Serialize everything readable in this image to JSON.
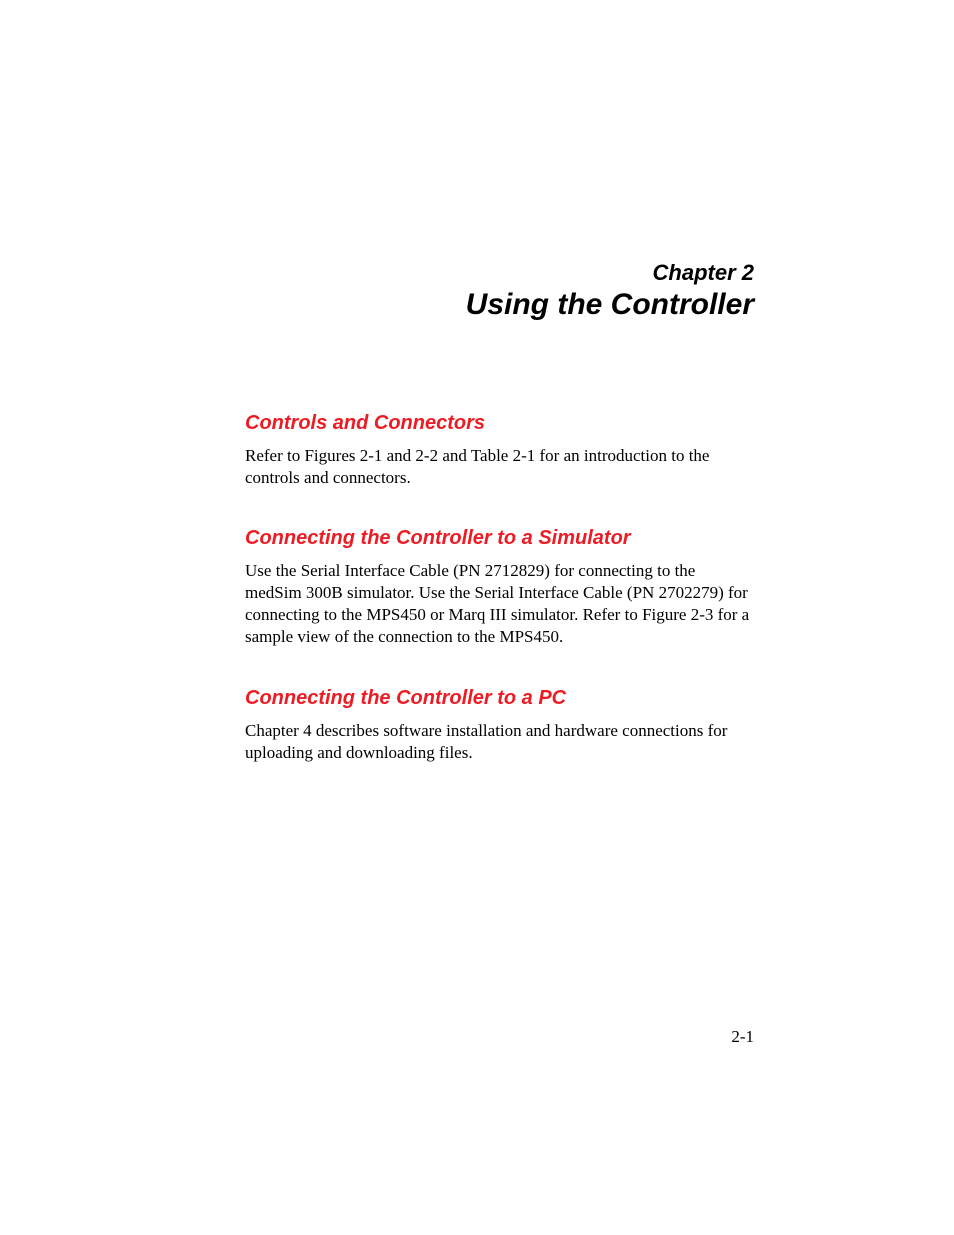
{
  "chapter": {
    "label": "Chapter 2",
    "title": "Using the Controller"
  },
  "sections": [
    {
      "heading": "Controls and Connectors",
      "body": "Refer to Figures 2-1 and 2-2 and Table 2-1 for an introduction to the controls and connectors."
    },
    {
      "heading": "Connecting the Controller to a Simulator",
      "body": "Use the Serial Interface Cable (PN 2712829) for connecting to the medSim 300B simulator. Use the Serial Interface Cable (PN 2702279) for connecting to the MPS450 or Marq III simulator. Refer to Figure 2-3 for a sample view of the connection to the MPS450."
    },
    {
      "heading": "Connecting the Controller to a PC",
      "body": "Chapter 4 describes software installation and hardware connections for uploading and downloading files."
    }
  ],
  "pageNumber": "2-1"
}
